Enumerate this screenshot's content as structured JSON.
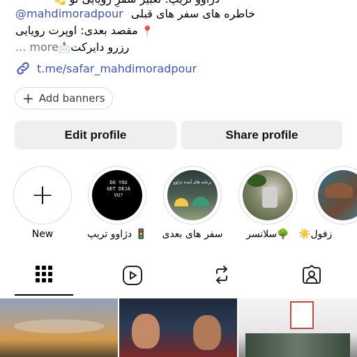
{
  "bio": {
    "line0": "دژاوو تریپ: تعبیر سفرِ رویایی تو",
    "line1_text": "خاطره های سفر های قبلی",
    "line1_mention": "@mahdimoradpour",
    "line2_text": "مقصد بعدی: اوپرت  رویایی",
    "line3_text": "رزرو دایرکت",
    "line3_more": "... more"
  },
  "link": {
    "text": "t.me/safar_mahdimoradpour"
  },
  "banner_button": {
    "label": "Add banners"
  },
  "actions": {
    "edit": "Edit profile",
    "share": "Share profile"
  },
  "highlights": [
    {
      "label": "New"
    },
    {
      "label": "دژاوو تریپ 🚦",
      "cover_text": "DO YOU GET DÉJÀ VU?"
    },
    {
      "label": "سفر های بعدی",
      "cover_text": "برنامه های آینده دژاوو"
    },
    {
      "label": "سلانسر🌳"
    },
    {
      "label": "☀️زفول"
    }
  ],
  "tabs": [
    "grid-icon",
    "reels-icon",
    "reposts-icon",
    "tagged-icon"
  ],
  "colors": {
    "link": "#3c53c7",
    "button_bg": "#efefef",
    "border": "#dbdbdb"
  }
}
